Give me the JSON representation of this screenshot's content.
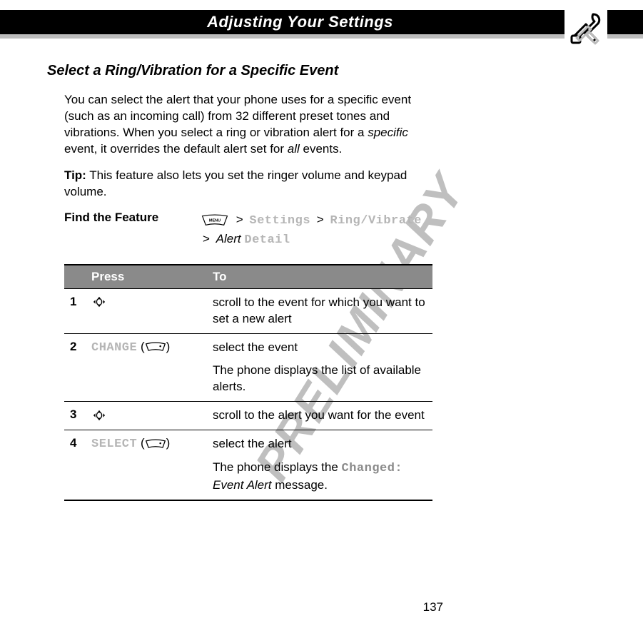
{
  "header": {
    "title": "Adjusting Your Settings",
    "icon": "tools-icon"
  },
  "section": {
    "title": "Select a Ring/Vibration for a Specific Event",
    "intro_parts": {
      "a": "You can select the alert that your phone uses for a specific event (such as an incoming call) from 32 different preset tones and vibrations. When you select a ring or vibration alert for a ",
      "specific": "specific",
      "b": " event, it overrides the default alert set for ",
      "all": "all",
      "c": " events."
    },
    "tip_label": "Tip:",
    "tip_text": " This feature also lets you set the ringer volume and keypad volume."
  },
  "find": {
    "label": "Find the Feature",
    "menu_key": "MENU",
    "gt": ">",
    "settings": "Settings",
    "ringvib": "Ring/Vibrate",
    "alert_word": "Alert",
    "detail": "Detail"
  },
  "table": {
    "head_press": "Press",
    "head_to": "To",
    "rows": [
      {
        "n": "1",
        "press_type": "nav",
        "to": "scroll to the event for which you want to set a new alert"
      },
      {
        "n": "2",
        "press_type": "softkey",
        "press_label": "CHANGE",
        "to": "select the event",
        "sub": "The phone displays the list of available alerts."
      },
      {
        "n": "3",
        "press_type": "nav",
        "to": "scroll to the alert you want for the event"
      },
      {
        "n": "4",
        "press_type": "softkey",
        "press_label": "SELECT",
        "to": "select the alert",
        "sub_a": "The phone displays the ",
        "sub_changed": "Changed:",
        "sub_event_alert": " Event Alert",
        "sub_b": " message."
      }
    ]
  },
  "watermark": "PRELIMINARY",
  "page_number": "137"
}
